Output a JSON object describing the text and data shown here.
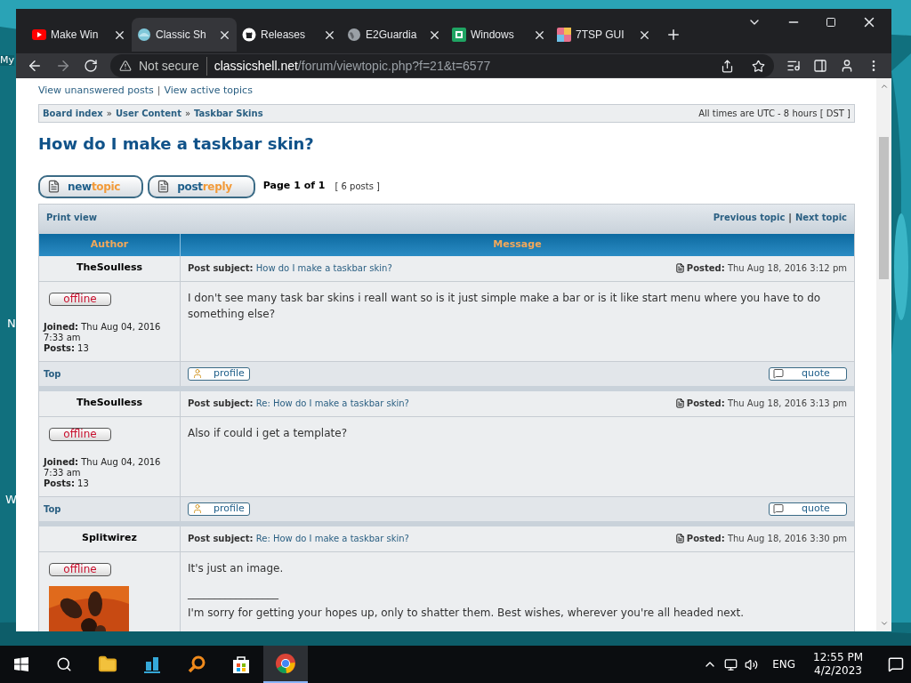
{
  "desktop_labels": [
    "My",
    "N",
    "W"
  ],
  "tabs": [
    {
      "kind": "video",
      "label": "Make Win",
      "selected": false
    },
    {
      "kind": "shell",
      "label": "Classic Sh",
      "selected": true
    },
    {
      "kind": "github",
      "label": "Releases",
      "selected": false
    },
    {
      "kind": "globe",
      "label": "E2Guardia",
      "selected": false
    },
    {
      "kind": "sheet",
      "label": "Windows",
      "selected": false
    },
    {
      "kind": "sp",
      "label": "7TSP GUI",
      "selected": false
    }
  ],
  "address_bar": {
    "security": "Not secure",
    "host": "classicshell.net",
    "path": "/forum/viewtopic.php?f=21&t=6577"
  },
  "top_links": [
    "View unanswered posts",
    "View active topics"
  ],
  "link_separator": "|",
  "breadcrumb_separator": "»",
  "breadcrumbs": [
    "Board index",
    "User Content",
    "Taskbar Skins"
  ],
  "timezone": "All times are UTC - 8 hours [ DST ]",
  "topic_title": "How do I make a taskbar skin?",
  "action_buttons": [
    {
      "first": "new",
      "second": "topic"
    },
    {
      "first": "post",
      "second": "reply"
    }
  ],
  "pagination": {
    "page": "Page 1 of 1",
    "count": "[ 6 posts ]"
  },
  "print_view": "Print view",
  "nav_links": [
    "Previous topic",
    "Next topic"
  ],
  "nav_separator": "|",
  "columns": [
    "Author",
    "Message"
  ],
  "posts": [
    {
      "author": "TheSoulless",
      "status": "offline",
      "joined_label": "Joined:",
      "joined": "Thu Aug 04, 2016 7:33 am",
      "posts_label": "Posts:",
      "posts": "13",
      "subject_label": "Post subject:",
      "subject": "How do I make a taskbar skin?",
      "posted_label": "Posted:",
      "posted": "Thu Aug 18, 2016 3:12 pm",
      "body": "I don't see many task bar skins i reall want so is it just simple make a bar or is it like start menu where you have to do something else?",
      "top": "Top",
      "profile": "profile",
      "quote": "quote"
    },
    {
      "author": "TheSoulless",
      "status": "offline",
      "joined_label": "Joined:",
      "joined": "Thu Aug 04, 2016 7:33 am",
      "posts_label": "Posts:",
      "posts": "13",
      "subject_label": "Post subject:",
      "subject": "Re: How do I make a taskbar skin?",
      "posted_label": "Posted:",
      "posted": "Thu Aug 18, 2016 3:13 pm",
      "body": "Also if could i get a template?",
      "top": "Top",
      "profile": "profile",
      "quote": "quote"
    },
    {
      "author": "Splitwirez",
      "status": "offline",
      "subject_label": "Post subject:",
      "subject": "Re: How do I make a taskbar skin?",
      "posted_label": "Posted:",
      "posted": "Thu Aug 18, 2016 3:30 pm",
      "body": "It's just an image.",
      "signature_rule": "_________________",
      "signature": "I'm sorry for getting your hopes up, only to shatter them. Best wishes, wherever you're all headed next."
    }
  ],
  "tray": {
    "language": "ENG",
    "time": "12:55 PM",
    "date": "4/2/2023"
  }
}
